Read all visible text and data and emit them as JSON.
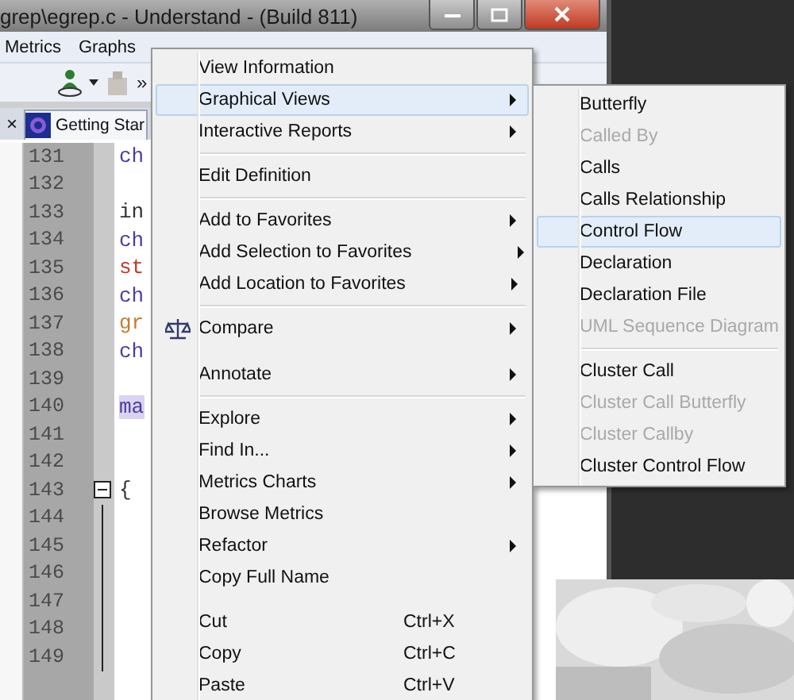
{
  "window": {
    "title": "grep\\egrep.c - Understand - (Build 811)"
  },
  "menubar": [
    {
      "label": "Metrics"
    },
    {
      "label": "Graphs"
    }
  ],
  "toolbar": {
    "overflow": "»"
  },
  "tabs": [
    {
      "close": "×",
      "label": "Getting Star",
      "selected": true
    }
  ],
  "editor": {
    "lines": [
      {
        "number": "131",
        "code": "ch",
        "color": "#4b3f9c"
      },
      {
        "number": "132"
      },
      {
        "number": "133",
        "code": "in",
        "color": "#333333"
      },
      {
        "number": "134",
        "code": "ch",
        "color": "#4b3f9c"
      },
      {
        "number": "135",
        "code": "st",
        "color": "#c0392b"
      },
      {
        "number": "136",
        "code": "ch",
        "color": "#4b3f9c"
      },
      {
        "number": "137",
        "code": "gr",
        "color": "#c87a30"
      },
      {
        "number": "138",
        "code": "ch",
        "color": "#4b3f9c"
      },
      {
        "number": "139"
      },
      {
        "number": "140",
        "code": "ma",
        "color": "#4b3f9c",
        "highlighted": true
      },
      {
        "number": "141"
      },
      {
        "number": "142"
      },
      {
        "number": "143",
        "code": "{",
        "color": "#333333",
        "fold_marker": true,
        "collapsed": false
      },
      {
        "number": "144"
      },
      {
        "number": "145"
      },
      {
        "number": "146"
      },
      {
        "number": "147"
      },
      {
        "number": "148"
      },
      {
        "number": "149"
      }
    ]
  },
  "context_menu": {
    "items": [
      {
        "kind": "item",
        "label": "View Information",
        "submenu": false,
        "selected": false
      },
      {
        "kind": "item",
        "label": "Graphical Views",
        "submenu": true,
        "selected": true
      },
      {
        "kind": "item",
        "label": "Interactive Reports",
        "submenu": true,
        "selected": false
      },
      {
        "kind": "separator"
      },
      {
        "kind": "item",
        "label": "Edit Definition",
        "submenu": false,
        "selected": false
      },
      {
        "kind": "separator"
      },
      {
        "kind": "item",
        "label": "Add to Favorites",
        "submenu": true,
        "selected": false
      },
      {
        "kind": "item",
        "label": "Add Selection to Favorites",
        "submenu": true,
        "selected": false
      },
      {
        "kind": "item",
        "label": "Add Location to Favorites",
        "submenu": true,
        "selected": false
      },
      {
        "kind": "separator"
      },
      {
        "kind": "scale_item",
        "label": "Compare",
        "submenu": true,
        "selected": false
      },
      {
        "kind": "gap"
      },
      {
        "kind": "item",
        "label": "Annotate",
        "submenu": true,
        "selected": false
      },
      {
        "kind": "separator"
      },
      {
        "kind": "item",
        "label": "Explore",
        "submenu": true,
        "selected": false
      },
      {
        "kind": "item",
        "label": "Find In...",
        "submenu": true,
        "selected": false
      },
      {
        "kind": "item",
        "label": "Metrics Charts",
        "submenu": true,
        "selected": false
      },
      {
        "kind": "item",
        "label": "Browse Metrics",
        "submenu": false,
        "selected": false
      },
      {
        "kind": "item",
        "label": "Refactor",
        "submenu": true,
        "selected": false
      },
      {
        "kind": "item",
        "label": "Copy Full Name",
        "submenu": false,
        "selected": false
      },
      {
        "kind": "gap"
      },
      {
        "kind": "item",
        "label": "Cut",
        "shortcut": "Ctrl+X",
        "submenu": false,
        "selected": false
      },
      {
        "kind": "item",
        "label": "Copy",
        "shortcut": "Ctrl+C",
        "submenu": false,
        "selected": false
      },
      {
        "kind": "item",
        "label": "Paste",
        "shortcut": "Ctrl+V",
        "submenu": false,
        "selected": false
      }
    ]
  },
  "submenu": {
    "items": [
      {
        "kind": "item",
        "label": "Butterfly",
        "disabled": false,
        "selected": false
      },
      {
        "kind": "item",
        "label": "Called By",
        "disabled": true,
        "selected": false
      },
      {
        "kind": "item",
        "label": "Calls",
        "disabled": false,
        "selected": false
      },
      {
        "kind": "item",
        "label": "Calls Relationship",
        "disabled": false,
        "selected": false
      },
      {
        "kind": "item",
        "label": "Control Flow",
        "disabled": false,
        "selected": true
      },
      {
        "kind": "item",
        "label": "Declaration",
        "disabled": false,
        "selected": false
      },
      {
        "kind": "item",
        "label": "Declaration File",
        "disabled": false,
        "selected": false
      },
      {
        "kind": "item",
        "label": "UML Sequence Diagram",
        "disabled": true,
        "selected": false
      },
      {
        "kind": "separator"
      },
      {
        "kind": "item",
        "label": "Cluster Call",
        "disabled": false,
        "selected": false
      },
      {
        "kind": "item",
        "label": "Cluster Call Butterfly",
        "disabled": true,
        "selected": false
      },
      {
        "kind": "item",
        "label": "Cluster Callby",
        "disabled": true,
        "selected": false
      },
      {
        "kind": "item",
        "label": "Cluster Control Flow",
        "disabled": false,
        "selected": false
      }
    ]
  }
}
